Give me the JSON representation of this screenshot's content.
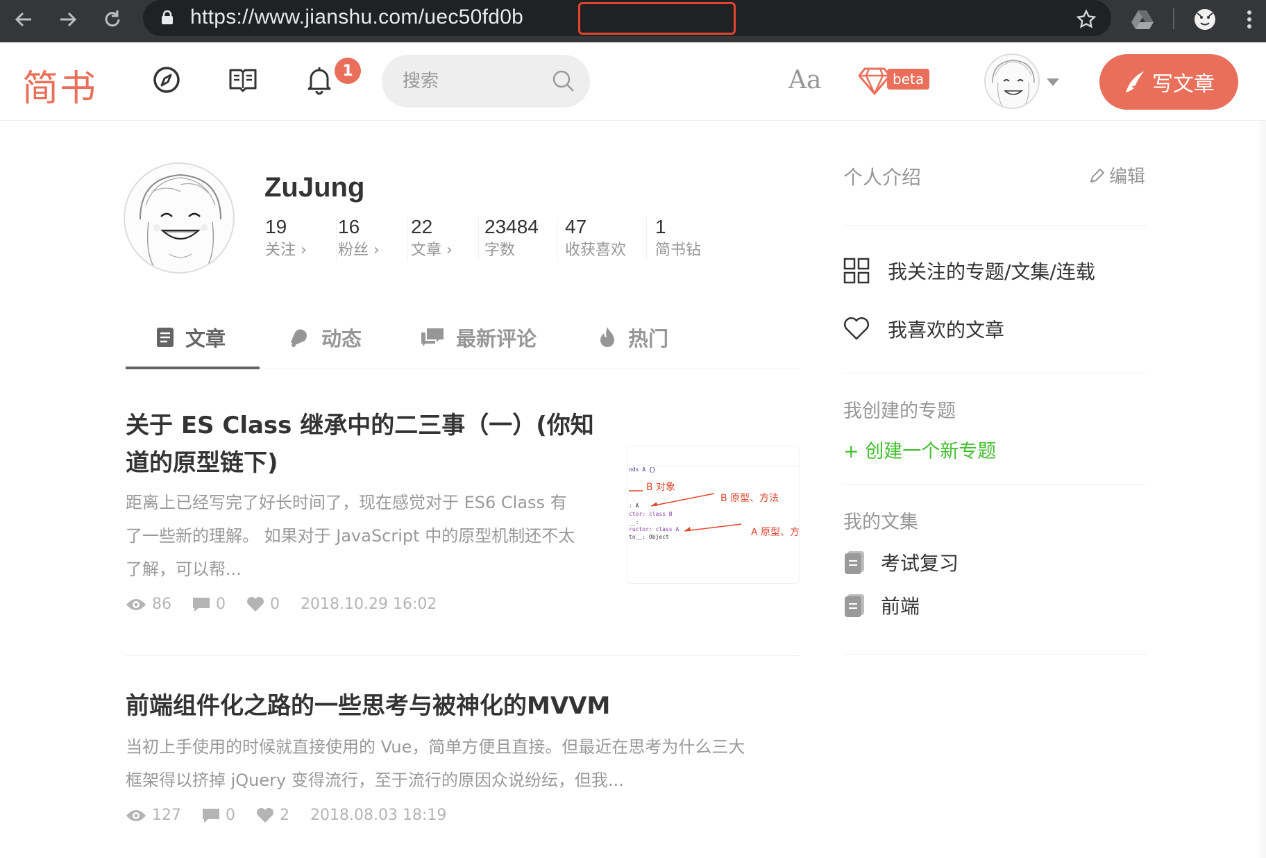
{
  "browser": {
    "url_host": "https://www.jianshu.com/u",
    "url_path": "ec50fd0b",
    "icons": [
      "back-arrow-icon",
      "forward-arrow-icon",
      "reload-icon",
      "lock-icon",
      "star-icon",
      "drive-icon",
      "profile-icon",
      "menu-dots-icon"
    ]
  },
  "header": {
    "logo": "简书",
    "notification_count": "1",
    "search_placeholder": "搜索",
    "font_toggle": "Aa",
    "beta_label": "beta",
    "write_button": "写文章"
  },
  "profile": {
    "username": "ZuJung",
    "stats": [
      {
        "num": "19",
        "label": "关注 ›"
      },
      {
        "num": "16",
        "label": "粉丝 ›"
      },
      {
        "num": "22",
        "label": "文章 ›"
      },
      {
        "num": "23484",
        "label": "字数"
      },
      {
        "num": "47",
        "label": "收获喜欢"
      },
      {
        "num": "1",
        "label": "简书钻"
      }
    ]
  },
  "tabs": [
    {
      "label": "文章",
      "active": true
    },
    {
      "label": "动态",
      "active": false
    },
    {
      "label": "最新评论",
      "active": false
    },
    {
      "label": "热门",
      "active": false
    }
  ],
  "articles": [
    {
      "title": "关于 ES Class 继承中的二三事（一）(你知道的原型链下)",
      "title_line1": "关于 ES Class 继承中的二三事（一）(你知",
      "title_line2": "道的原型链下)",
      "abstract_line1": "距离上已经写完了好长时间了，现在感觉对于 ES6 Class 有",
      "abstract_line2": "了一些新的理解。 如果对于 JavaScript 中的原型机制还不太",
      "abstract_line3": "了解，可以帮...",
      "views": "86",
      "comments": "0",
      "likes": "0",
      "date": "2018.10.29 16:02",
      "thumb": {
        "code_lines": [
          "nds A {}",
          ": A",
          "ctor: class B",
          "__:",
          "ructor: class A",
          "to__: Object"
        ],
        "labels": [
          "B 对象",
          "B 原型、方法",
          "A 原型、方"
        ]
      }
    },
    {
      "title": "前端组件化之路的一些思考与被神化的MVVM",
      "abstract_line1": "当初上手使用的时候就直接使用的 Vue，简单方便且直接。但最近在思考为什么三大",
      "abstract_line2": "框架得以挤掉 jQuery 变得流行，至于流行的原因众说纷纭，但我...",
      "views": "127",
      "comments": "0",
      "likes": "2",
      "date": "2018.08.03 18:19"
    }
  ],
  "sidebar": {
    "intro_title": "个人介绍",
    "edit_label": "编辑",
    "links": [
      {
        "label": "我关注的专题/文集/连载",
        "icon": "grid-icon"
      },
      {
        "label": "我喜欢的文章",
        "icon": "heart-icon"
      }
    ],
    "created_topics_title": "我创建的专题",
    "create_topic": "+ 创建一个新专题",
    "collections_title": "我的文集",
    "collections": [
      "考试复习",
      "前端"
    ]
  },
  "colors": {
    "brand": "#ea6f5a",
    "green": "#42c02e",
    "muted": "#969696"
  }
}
